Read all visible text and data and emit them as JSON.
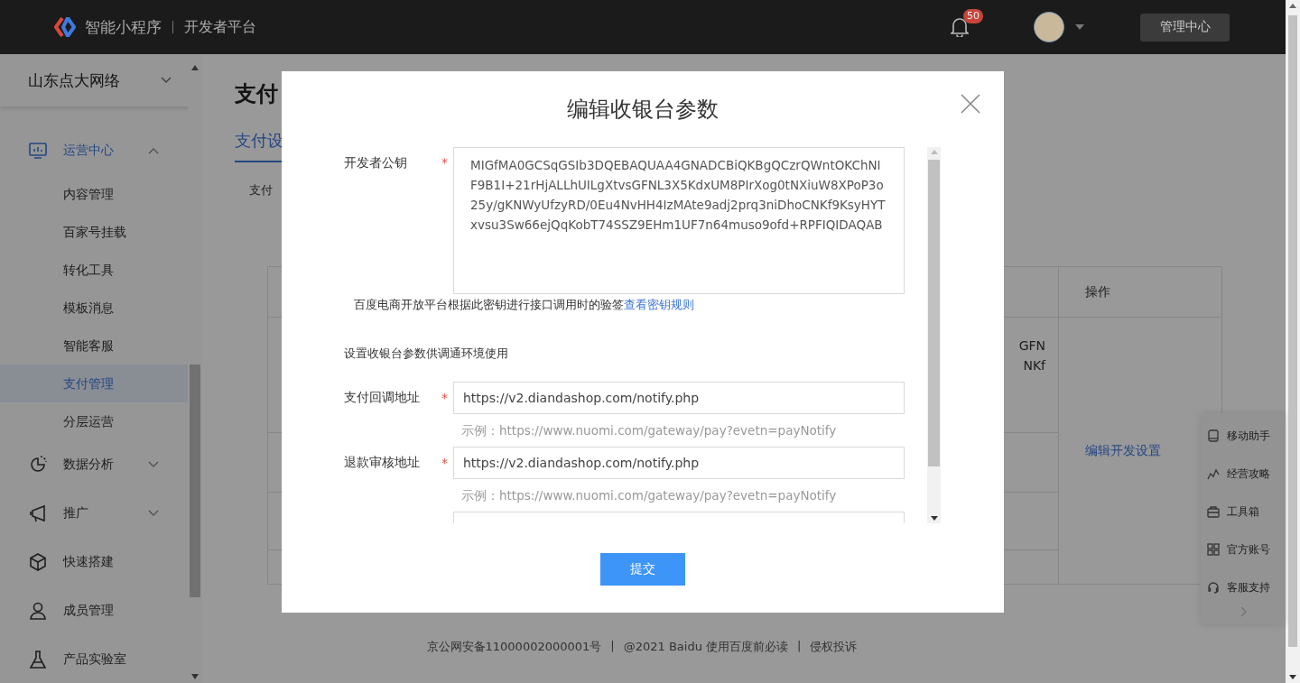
{
  "topbar": {
    "product": "智能小程序",
    "platform": "开发者平台",
    "notification_count": "50",
    "button": "管理中心"
  },
  "sidebar": {
    "account": "山东点大网络",
    "items": [
      {
        "label": "运营中心",
        "expanded": true,
        "children": [
          {
            "label": "内容管理",
            "selected": false
          },
          {
            "label": "百家号挂载",
            "selected": false
          },
          {
            "label": "转化工具",
            "selected": false
          },
          {
            "label": "模板消息",
            "selected": false
          },
          {
            "label": "智能客服",
            "selected": false
          },
          {
            "label": "支付管理",
            "selected": true
          },
          {
            "label": "分层运营",
            "selected": false
          }
        ]
      },
      {
        "label": "数据分析",
        "expanded": false
      },
      {
        "label": "推广",
        "expanded": false
      },
      {
        "label": "快速搭建"
      },
      {
        "label": "成员管理"
      },
      {
        "label": "产品实验室"
      }
    ]
  },
  "page": {
    "heading": "支付",
    "tabs": [
      {
        "label": "支付设",
        "selected": true
      }
    ],
    "subtab": "支付",
    "table": {
      "columns": [
        "操作"
      ],
      "cell_fragment": [
        "GFN",
        "NKf"
      ],
      "action_link": "编辑开发设置"
    }
  },
  "side_panel": {
    "items": [
      "移动助手",
      "经营攻略",
      "工具箱",
      "官方账号",
      "客服支持"
    ]
  },
  "footer": {
    "separator": "|",
    "items": [
      "京公网安备11000002000001号",
      "@2021 Baidu 使用百度前必读",
      "侵权投诉"
    ]
  },
  "modal": {
    "title": "编辑收银台参数",
    "submit": "提交",
    "required_mark": "*",
    "fields": [
      {
        "kind": "textarea",
        "label": "开发者公钥",
        "required": true,
        "value": "MIGfMA0GCSqGSIb3DQEBAQUAA4GNADCBiQKBgQCzrQWntOKChNIF9B1I+21rHjALLhUILgXtvsGFNL3X5KdxUM8PIrXog0tNXiuW8XPoP3o25y/gKNWyUfzyRD/0Eu4NvHH4IzMAte9adj2prq3niDhoCNKf9KsyHYTxvsu3Sw66ejQqKobT74SSZ9EHm1UF7n64muso9ofd+RPFIQIDAQAB",
        "hint": "百度电商开放平台根据此密钥进行接口调用时的验签",
        "hint_link": "查看密钥规则"
      },
      {
        "kind": "note",
        "label": "设置收银台参数供调通环境使用"
      },
      {
        "kind": "input",
        "label": "支付回调地址",
        "required": true,
        "value": "https://v2.diandashop.com/notify.php",
        "example": "示例：https://www.nuomi.com/gateway/pay?evetn=payNotify"
      },
      {
        "kind": "input",
        "label": "退款审核地址",
        "required": true,
        "value": "https://v2.diandashop.com/notify.php",
        "example": "示例：https://www.nuomi.com/gateway/pay?evetn=payNotify"
      },
      {
        "kind": "input"
      }
    ]
  }
}
